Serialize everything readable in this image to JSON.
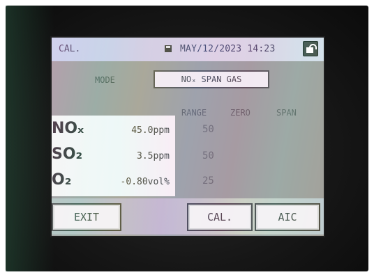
{
  "screen": {
    "title": "CAL.",
    "datetime": "MAY/12/2023 14:23",
    "mode": {
      "label": "MODE",
      "value": "NOₓ SPAN GAS"
    },
    "columns": {
      "range": "RANGE",
      "zero": "ZERO",
      "span": "SPAN"
    },
    "gases": [
      {
        "name": "NOₓ",
        "value": "45.0ppm",
        "range": "50"
      },
      {
        "name": "SO₂",
        "value": "3.5ppm",
        "range": "50"
      },
      {
        "name": "O₂",
        "value": "-0.80vol%",
        "range": "25"
      }
    ],
    "buttons": {
      "exit": "EXIT",
      "cal": "CAL.",
      "aic": "AIC"
    }
  },
  "icons": [
    "save-icon",
    "unlock-icon"
  ]
}
